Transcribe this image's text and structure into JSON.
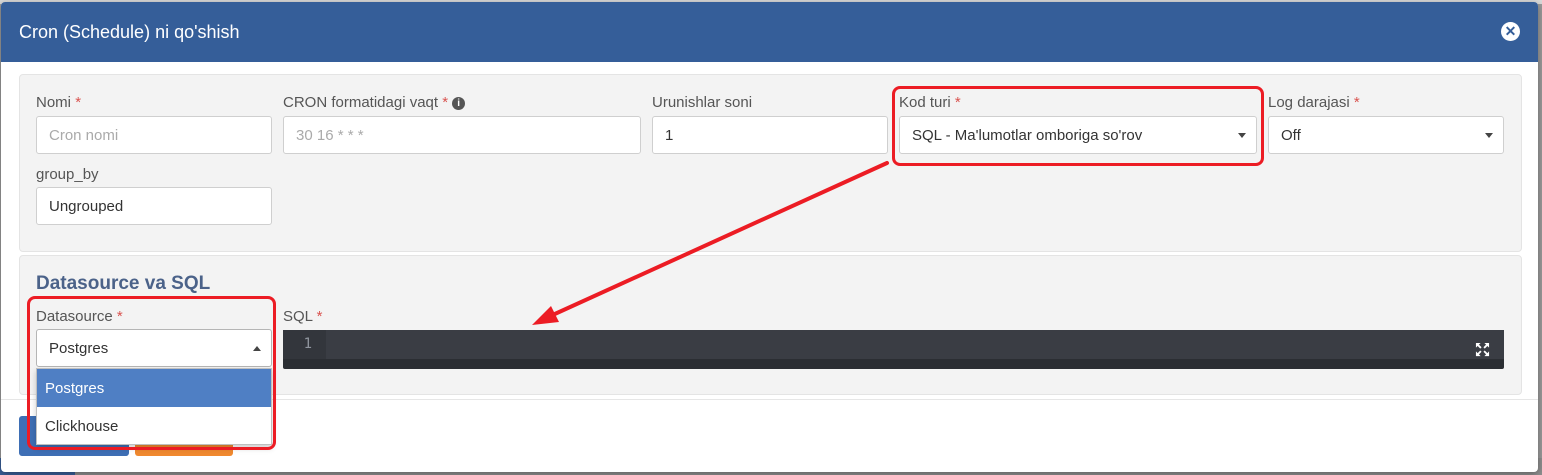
{
  "modal": {
    "title": "Cron (Schedule) ni qo'shish",
    "close_icon": "close-circle-icon"
  },
  "fields": {
    "name": {
      "label": "Nomi",
      "required": "*",
      "placeholder": "Cron nomi"
    },
    "cron": {
      "label": "CRON formatidagi vaqt",
      "required": "*",
      "placeholder": "30 16 * * *",
      "info_icon": "info-icon"
    },
    "attempts": {
      "label": "Urunishlar soni",
      "value": "1"
    },
    "code_type": {
      "label": "Kod turi",
      "required": "*",
      "value": "SQL - Ma'lumotlar omboriga so'rov"
    },
    "log_level": {
      "label": "Log darajasi",
      "required": "*",
      "value": "Off"
    },
    "group_by": {
      "label": "group_by",
      "value": "Ungrouped"
    }
  },
  "datasource_section": {
    "title": "Datasource va SQL",
    "datasource": {
      "label": "Datasource",
      "required": "*",
      "value": "Postgres",
      "options": [
        "Postgres",
        "Clickhouse"
      ]
    },
    "sql": {
      "label": "SQL",
      "required": "*",
      "line_number": "1",
      "expand_icon": "expand-icon"
    }
  },
  "colors": {
    "header": "#355e99",
    "highlight": "#ec1c24",
    "option_active": "#4f7fc4"
  }
}
